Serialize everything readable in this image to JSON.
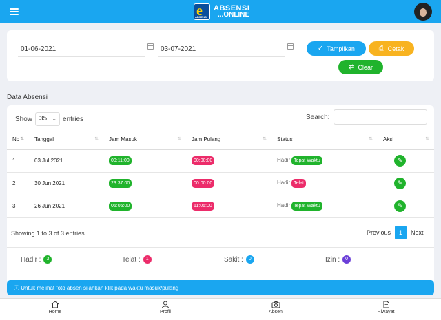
{
  "header": {
    "logo_line1": "ABSENSI",
    "logo_line2": "...ONLINE",
    "logo_badge": "e",
    "logo_badge_sub": "ABSENSI",
    "accent": "#1aa6f0"
  },
  "filter": {
    "date_from": "01-06-2021",
    "date_to": "03-07-2021",
    "show_label": "Tampilkan",
    "print_label": "Cetak",
    "clear_label": "Clear"
  },
  "section_title": "Data Absensi",
  "table": {
    "show_prefix": "Show",
    "entries_value": "35",
    "show_suffix": "entries",
    "search_label": "Search:",
    "columns": [
      "No",
      "Tanggal",
      "Jam Masuk",
      "Jam Pulang",
      "Status",
      "Aksi"
    ],
    "rows": [
      {
        "no": "1",
        "tanggal": "03 Jul 2021",
        "jam_masuk": "00:11:00",
        "jam_pulang": "00:00:00",
        "status": "Hadir",
        "keterangan": "Tepat Waktu"
      },
      {
        "no": "2",
        "tanggal": "30 Jun 2021",
        "jam_masuk": "23:37:00",
        "jam_pulang": "00:00:00",
        "status": "Hadir",
        "keterangan": "Telat"
      },
      {
        "no": "3",
        "tanggal": "26 Jun 2021",
        "jam_masuk": "05:05:00",
        "jam_pulang": "11:05:00",
        "status": "Hadir",
        "keterangan": "Tepat Waktu"
      }
    ],
    "showing_text": "Showing 1 to 3 of 3 entries",
    "prev_label": "Previous",
    "page": "1",
    "next_label": "Next"
  },
  "summary": {
    "hadir_label": "Hadir :",
    "hadir_count": "3",
    "telat_label": "Telat :",
    "telat_count": "1",
    "sakit_label": "Sakit :",
    "sakit_count": "0",
    "izin_label": "Izin :",
    "izin_count": "0"
  },
  "info_text": "ⓘ Untuk melihat foto absen silahkan klik pada waktu masuk/pulang",
  "nav": {
    "home": "Home",
    "profil": "Profil",
    "absen": "Absen",
    "riwayat": "Riwayat"
  }
}
